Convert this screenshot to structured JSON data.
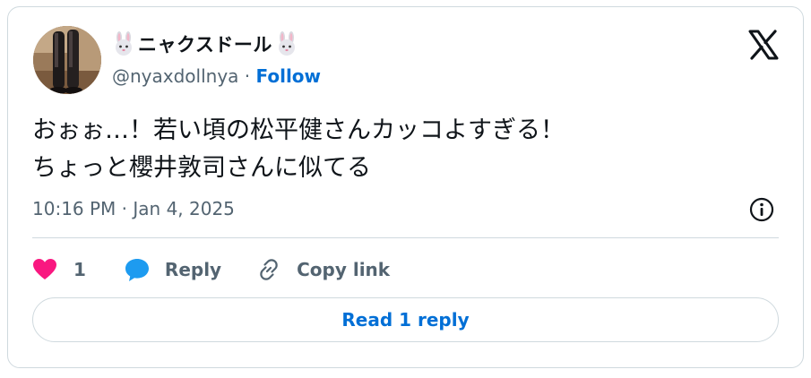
{
  "author": {
    "display_name": "ニャクスドール",
    "name_emoji_icon": "rabbit-face-icon",
    "handle": "@nyaxdollnya",
    "separator": "·",
    "follow_label": "Follow"
  },
  "tweet": {
    "text_lines": [
      "おぉぉ…！若い頃の松平健さんカッコよすぎる！",
      "ちょっと櫻井敦司さんに似てる"
    ],
    "timestamp": "10:16 PM · Jan 4, 2025"
  },
  "actions": {
    "like_count": "1",
    "reply_label": "Reply",
    "copy_link_label": "Copy link"
  },
  "read_replies_label": "Read 1 reply",
  "colors": {
    "accent": "#006fd6",
    "like": "#f91880",
    "text": "#0f1419",
    "muted": "#536471",
    "border": "#cfd9de"
  },
  "icons": [
    "x-logo-icon",
    "info-icon",
    "heart-icon",
    "reply-bubble-icon",
    "link-icon",
    "rabbit-face-icon"
  ]
}
